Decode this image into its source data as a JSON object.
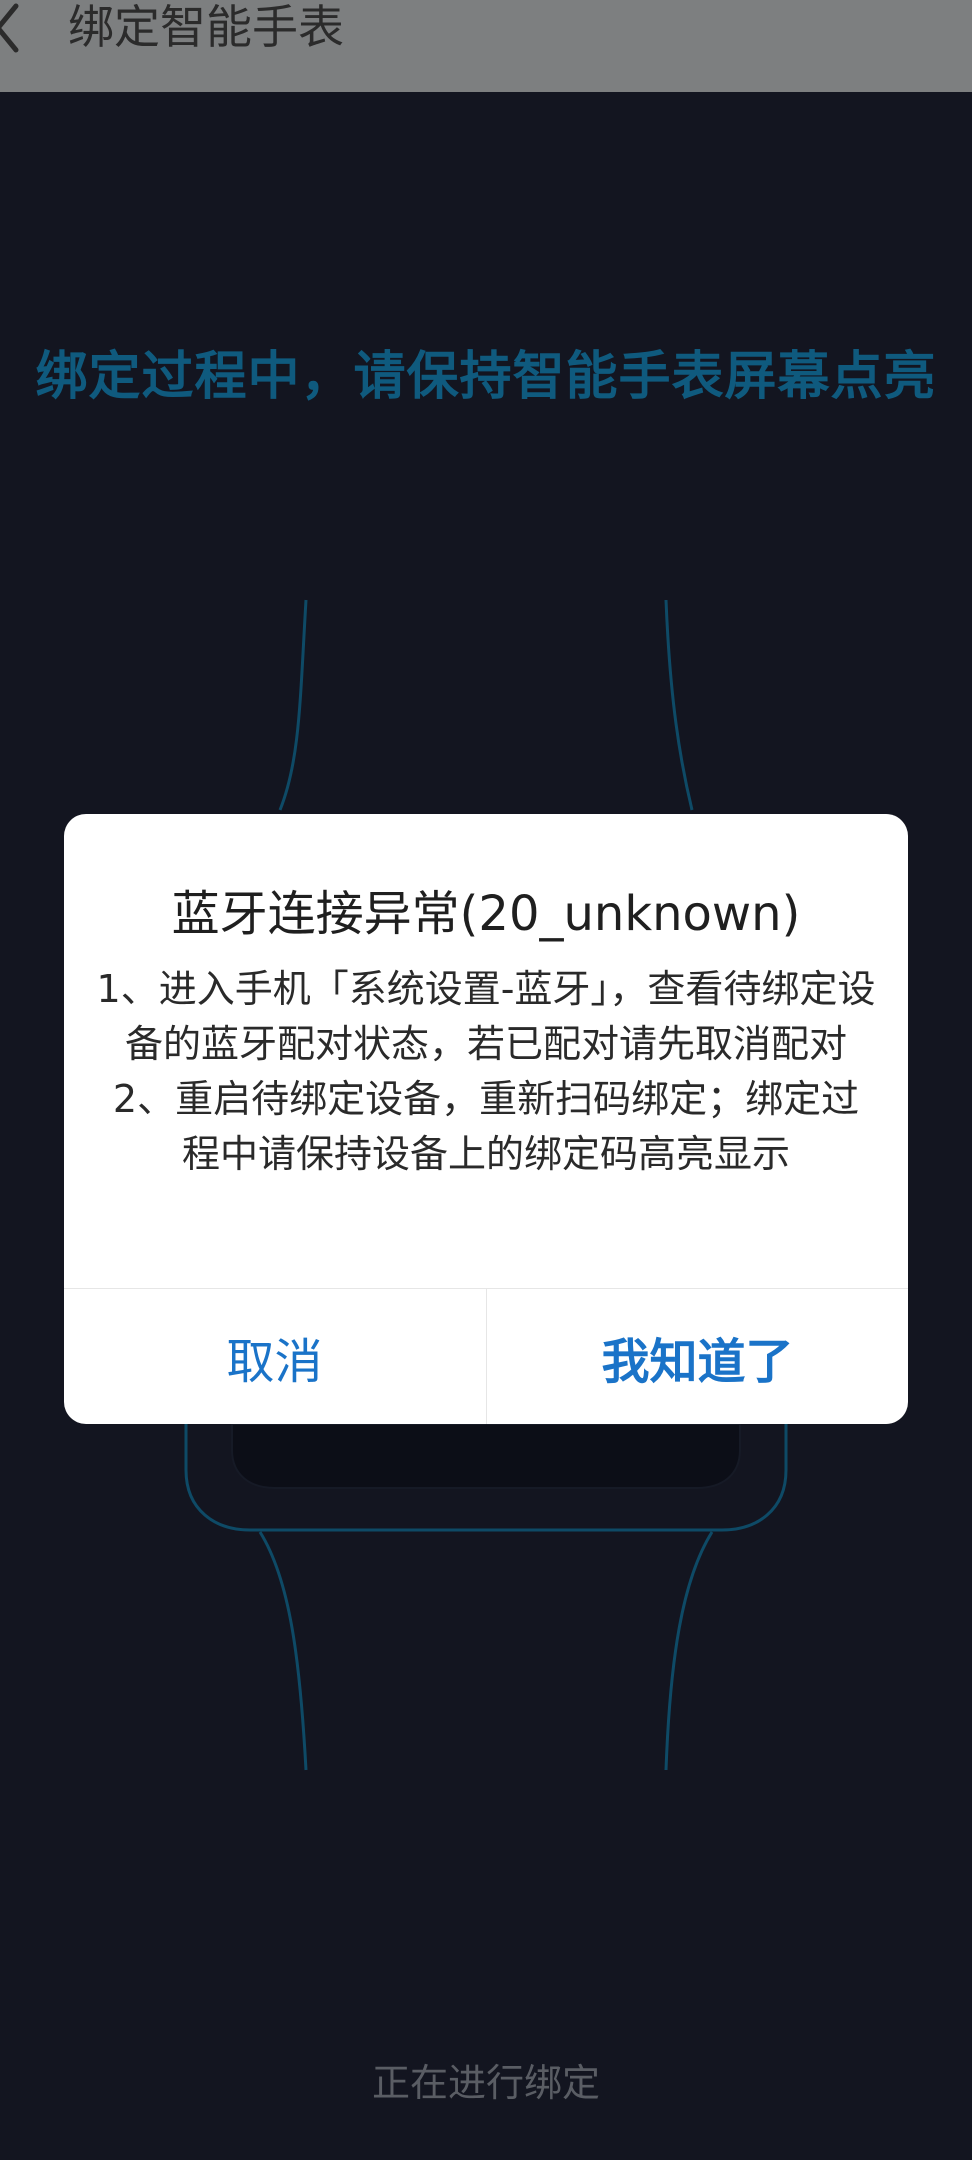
{
  "header": {
    "back_icon": "chevron-left-icon",
    "title": "绑定智能手表"
  },
  "main": {
    "instruction": "绑定过程中，请保持智能手表屏幕点亮",
    "status": "正在进行绑定"
  },
  "dialog": {
    "title": "蓝牙连接异常(20_unknown)",
    "body_lines": [
      "1、进入手机「系统设置-蓝牙」，查看待绑定设备的蓝牙配对状态，若已配对请先取消配对",
      "2、重启待绑定设备，重新扫码绑定；绑定过程中请保持设备上的绑定码高亮显示"
    ],
    "cancel_label": "取消",
    "ok_label": "我知道了"
  },
  "colors": {
    "background": "#131520",
    "instruction": "#0f5a7e",
    "accent": "#1a73c8",
    "watch_outline": "#0e4a66"
  }
}
